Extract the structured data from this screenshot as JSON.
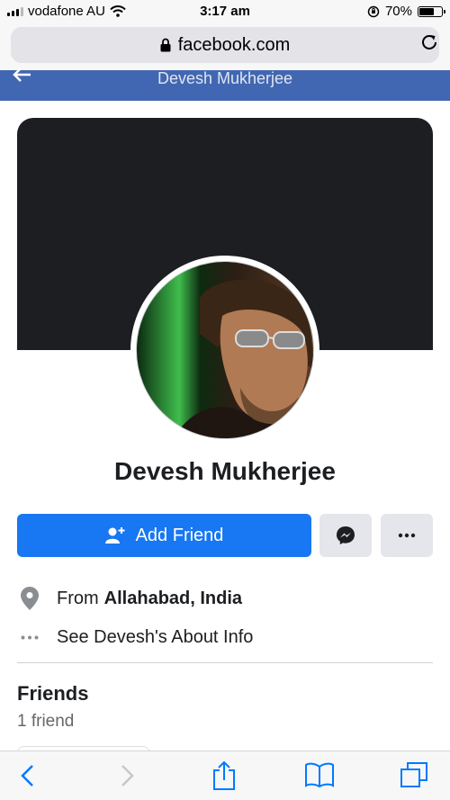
{
  "status_bar": {
    "carrier": "vodafone AU",
    "time": "3:17 am",
    "battery_percent": "70%",
    "battery_level": 0.7
  },
  "browser": {
    "url": "facebook.com"
  },
  "header": {
    "title": "Devesh Mukherjee"
  },
  "profile": {
    "name": "Devesh Mukherjee"
  },
  "actions": {
    "add_friend_label": "Add Friend"
  },
  "info": {
    "from_prefix": "From",
    "from_location": "Allahabad, India",
    "about_label": "See Devesh's About Info"
  },
  "friends": {
    "title": "Friends",
    "count": "1 friend"
  },
  "colors": {
    "fb_blue": "#4267b2",
    "button_blue": "#1877f2",
    "cover": "#1c1e21",
    "ios_blue": "#007aff"
  }
}
